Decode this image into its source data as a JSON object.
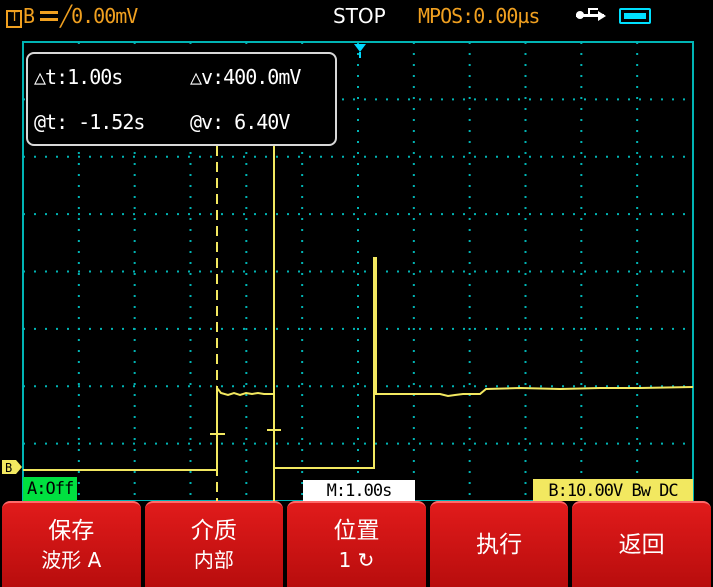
{
  "status_bar": {
    "trigger_source": "B",
    "trigger_source_box": "T",
    "trigger_edge": "╱",
    "trigger_level": "0.00mV",
    "run_state": "STOP",
    "horizontal_position": "MPOS:0.00µs",
    "usb_icon": "usb-icon",
    "battery_icon": "battery-icon"
  },
  "measurements": {
    "delta_t": "△t:1.00s",
    "delta_v": "△v:400.0mV",
    "at_t": "@t: -1.52s",
    "at_v": "@v: 6.40V"
  },
  "channels": {
    "b_marker": "B",
    "a_status": "A:Off",
    "b_info": "B:10.00V Bw DC"
  },
  "timebase": "M:1.00s",
  "softkeys": [
    {
      "title": "保存",
      "sub": "波形 A"
    },
    {
      "title": "介质",
      "sub": "内部"
    },
    {
      "title": "位置",
      "sub": "1 ↻"
    },
    {
      "title": "执行",
      "sub": ""
    },
    {
      "title": "返回",
      "sub": ""
    }
  ],
  "colors": {
    "grid": "#00b4b4",
    "trace_b": "#f2e860",
    "accent_orange": "#f0a020",
    "channel_a": "#00e040",
    "menu_red": "#d01414"
  }
}
